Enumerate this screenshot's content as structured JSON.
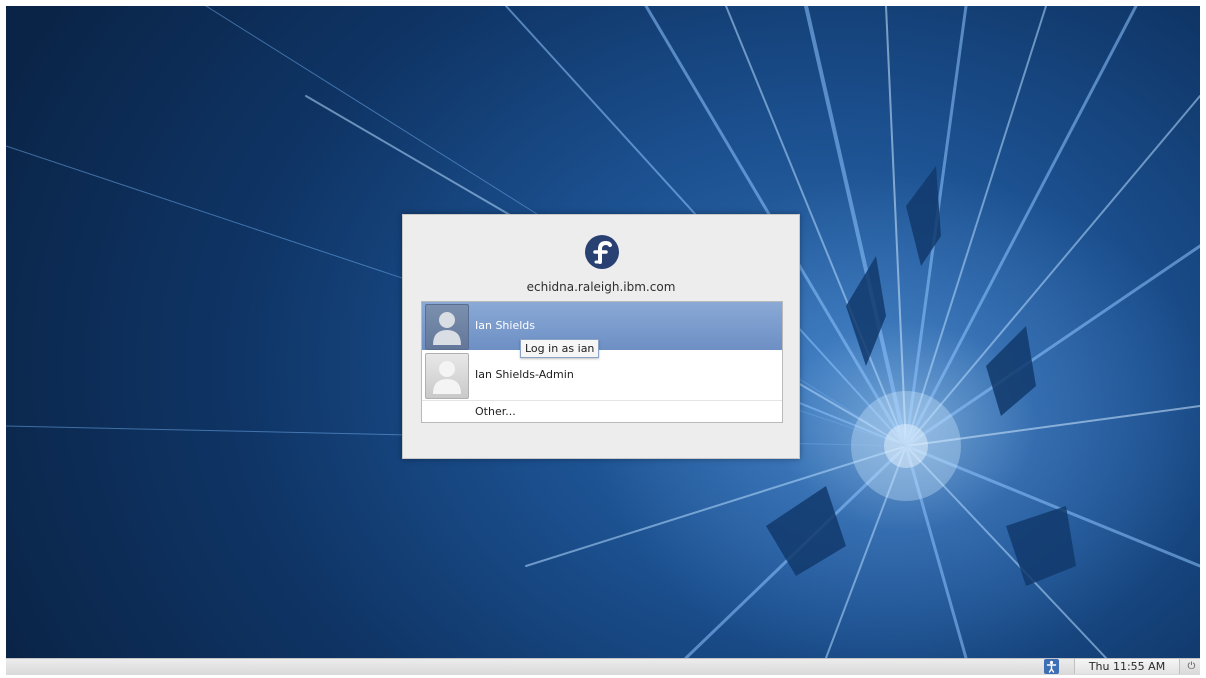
{
  "dialog": {
    "hostname": "echidna.raleigh.ibm.com",
    "logo": "fedora-logo-icon"
  },
  "users": [
    {
      "name": "Ian Shields",
      "selected": true,
      "icon": "user-avatar-icon"
    },
    {
      "name": "Ian Shields-Admin",
      "selected": false,
      "icon": "user-avatar-icon"
    }
  ],
  "other_label": "Other...",
  "tooltip": "Log in as ian",
  "panel": {
    "clock": "Thu 11:55 AM",
    "accessibility_icon": "accessibility-icon",
    "power_icon": "power-icon"
  },
  "colors": {
    "selection": "#7b9acc",
    "dialog_bg": "#ededed",
    "wallpaper_dark": "#0a2447",
    "wallpaper_light": "#2f6db0"
  }
}
